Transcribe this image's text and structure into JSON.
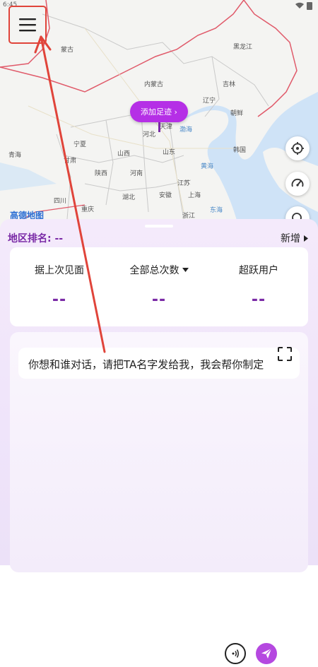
{
  "status_bar": {
    "time": "6:45"
  },
  "map": {
    "labels": [
      {
        "name": "mongolia",
        "text": "蒙古"
      },
      {
        "name": "heilongjiang",
        "text": "黑龙江"
      },
      {
        "name": "inner-mongolia",
        "text": "内蒙古"
      },
      {
        "name": "jilin",
        "text": "吉林"
      },
      {
        "name": "liaoning",
        "text": "辽宁"
      },
      {
        "name": "north-korea",
        "text": "朝鲜"
      },
      {
        "name": "tianjin",
        "text": "天津"
      },
      {
        "name": "hebei",
        "text": "河北"
      },
      {
        "name": "ningxia",
        "text": "宁夏"
      },
      {
        "name": "shanxi",
        "text": "山西"
      },
      {
        "name": "shandong",
        "text": "山东"
      },
      {
        "name": "south-korea",
        "text": "韩国"
      },
      {
        "name": "qinghai",
        "text": "青海"
      },
      {
        "name": "gansu",
        "text": "甘肃"
      },
      {
        "name": "shaanxi",
        "text": "陕西"
      },
      {
        "name": "henan",
        "text": "河南"
      },
      {
        "name": "jiangsu",
        "text": "江苏"
      },
      {
        "name": "hubei",
        "text": "湖北"
      },
      {
        "name": "anhui",
        "text": "安徽"
      },
      {
        "name": "shanghai",
        "text": "上海"
      },
      {
        "name": "sichuan",
        "text": "四川"
      },
      {
        "name": "chongqing",
        "text": "重庆"
      },
      {
        "name": "zhejiang",
        "text": "浙江"
      }
    ],
    "sea_labels": [
      {
        "name": "bohai",
        "text": "渤海"
      },
      {
        "name": "yellow-sea",
        "text": "黄海"
      },
      {
        "name": "east-sea",
        "text": "东海"
      }
    ],
    "add_footprint_label": "添加足迹 ›",
    "logo_text": "高德地图"
  },
  "sheet": {
    "rank_label": "地区排名:",
    "rank_value": "--",
    "add_new_label": "新增",
    "stats": [
      {
        "title": "据上次见面",
        "value": "--",
        "has_dropdown": false
      },
      {
        "title": "全部总次数",
        "value": "--",
        "has_dropdown": true
      },
      {
        "title": "超跃用户",
        "value": "--",
        "has_dropdown": false
      }
    ],
    "chat_message": "你想和谁对话，请把TA名字发给我，我会帮你制定",
    "input_placeholder": ""
  },
  "colors": {
    "accent": "#b52fe6",
    "brand_text": "#7a2aa6",
    "annotation": "#e0443a"
  }
}
